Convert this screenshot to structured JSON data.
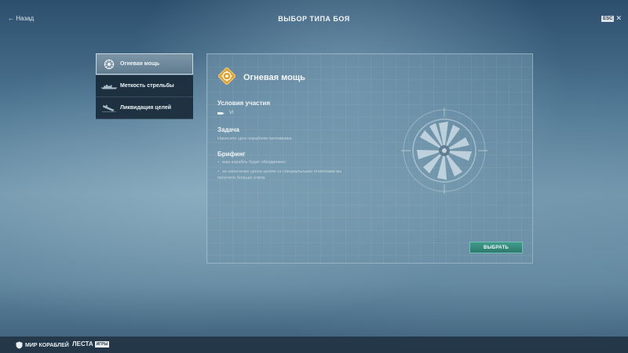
{
  "header": {
    "back_label": "← Назад",
    "title": "ВЫБОР ТИПА БОЯ",
    "esc_key": "ESC",
    "close_glyph": "✕"
  },
  "modes": [
    {
      "label": "Огневая мощь",
      "icon": "firepower-icon",
      "active": true
    },
    {
      "label": "Меткость стрельбы",
      "icon": "ship-silhouette-icon",
      "active": false
    },
    {
      "label": "Ликвидация целей",
      "icon": "sinking-ship-icon",
      "active": false
    }
  ],
  "panel": {
    "title": "Огневая мощь",
    "conditions_heading": "Условия участия",
    "tier": "VI",
    "task_heading": "Задача",
    "task_text": "Нанесите урон кораблям противника",
    "briefing_heading": "Брифинг",
    "briefing_items": [
      "ваш корабль будет обездвижен;",
      "за нанесение урона целям со специальными отметками вы получите больше очков."
    ],
    "select_label": "ВЫБРАТЬ"
  },
  "footer": {
    "brand1": "МИР КОРАБЛЕЙ",
    "brand2": "ЛЕСТА",
    "brand2_tag": "ИГРЫ"
  },
  "colors": {
    "accent_button": "#2d7a6e",
    "badge_gold": "#e0a12a"
  }
}
